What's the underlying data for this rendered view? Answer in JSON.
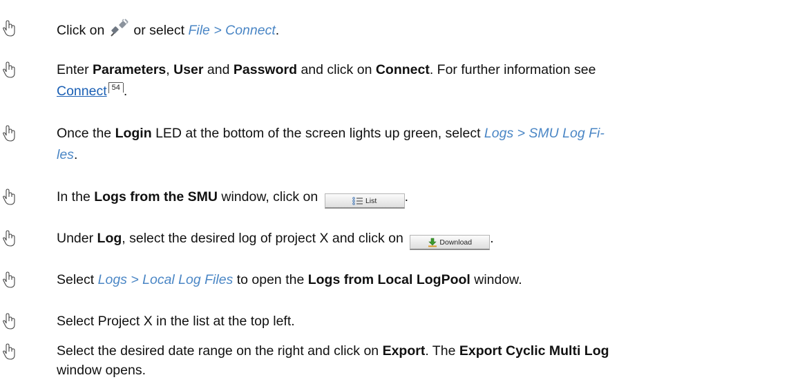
{
  "steps": [
    {
      "t1": "Click on",
      "t2": "or select",
      "menu": "File > Connect",
      "t3": "."
    },
    {
      "t1": "Enter",
      "b1": "Parameters",
      "t2": ",",
      "b2": "User",
      "t3": "and",
      "b3": "Password",
      "t4": "and click on",
      "b4": "Connect",
      "t5": ". For further information see",
      "link": "Connect",
      "ref": "54",
      "t6": "."
    },
    {
      "t1": "Once the",
      "b1": "Login",
      "t2": "LED at the bottom of the screen lights up green, select",
      "menu_a": "Logs > SMU Log Fi-",
      "menu_b": "les",
      "t3": "."
    },
    {
      "t1": "In the",
      "b1": "Logs from the SMU",
      "t2": "window, click on",
      "button": "List",
      "t3": "."
    },
    {
      "t1": "Under",
      "b1": "Log",
      "t2": ", select the desired log of project X and click on",
      "button": "Download",
      "t3": "."
    },
    {
      "t1": "Select",
      "menu": "Logs > Local Log Files",
      "t2": "to open the",
      "b1": "Logs from Local LogPool",
      "t3": "window."
    },
    {
      "t1": "Select Project X in the list at the top left."
    },
    {
      "t1": "Select the desired date range on the right and click on",
      "b1": "Export",
      "t2": ". The",
      "b2": "Export Cyclic Multi Log",
      "t3": "window opens."
    }
  ],
  "icons": {
    "bullet": "mouse-pointer-icon",
    "connect": "plug-connect-icon",
    "list": "list-icon",
    "download": "download-icon"
  },
  "colors": {
    "menu": "#4a86c5",
    "link": "#1a5fb4",
    "download_arrow": "#3c9a2e"
  }
}
